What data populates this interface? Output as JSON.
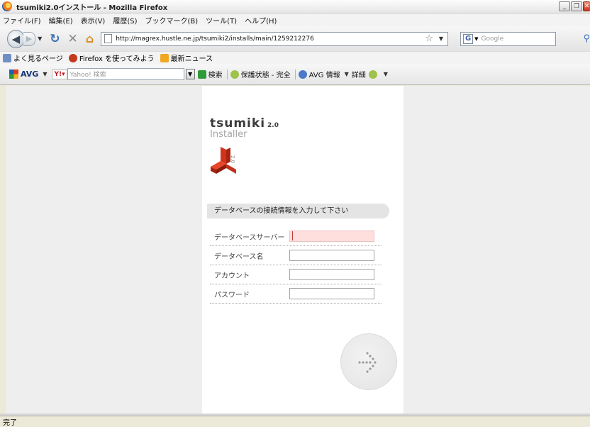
{
  "window": {
    "title": "tsumiki2.0インストール - Mozilla Firefox",
    "controls": [
      "minimize",
      "restore",
      "close"
    ]
  },
  "menubar": {
    "items": [
      {
        "label": "ファイル(F)"
      },
      {
        "label": "編集(E)"
      },
      {
        "label": "表示(V)"
      },
      {
        "label": "履歴(S)"
      },
      {
        "label": "ブックマーク(B)"
      },
      {
        "label": "ツール(T)"
      },
      {
        "label": "ヘルプ(H)"
      }
    ]
  },
  "navbar": {
    "url": "http://magrex.hustle.ne.jp/tsumiki2/installs/main/1259212276",
    "search_placeholder": "Google",
    "search_engine_letter": "G"
  },
  "bookmarks": {
    "items": [
      {
        "label": "よく見るページ"
      },
      {
        "label": "Firefox を使ってみよう"
      },
      {
        "label": "最新ニュース"
      }
    ]
  },
  "avg_toolbar": {
    "logo_label": "AVG",
    "yahoo_label": "Y!",
    "yahoo_search_placeholder": "Yahoo! 検索",
    "search_label": "検索",
    "protection_label": "保護状態 - 完全",
    "avg_info_label": "AVG 情報",
    "details_label": "詳細"
  },
  "installer": {
    "brand_name": "tsumiki",
    "brand_version": "2.0",
    "brand_subtitle": "Installer",
    "logo_version": "2.0",
    "section_title": "データベースの接続情報を入力して下さい",
    "fields": [
      {
        "label": "データベースサーバー",
        "value": ""
      },
      {
        "label": "データベース名",
        "value": ""
      },
      {
        "label": "アカウント",
        "value": ""
      },
      {
        "label": "パスワード",
        "value": ""
      }
    ]
  },
  "status": {
    "text": "完了"
  },
  "colors": {
    "active_field_bg": "#ffdede",
    "logo_red": "#d3321a",
    "section_bg": "#e4e4e4"
  }
}
